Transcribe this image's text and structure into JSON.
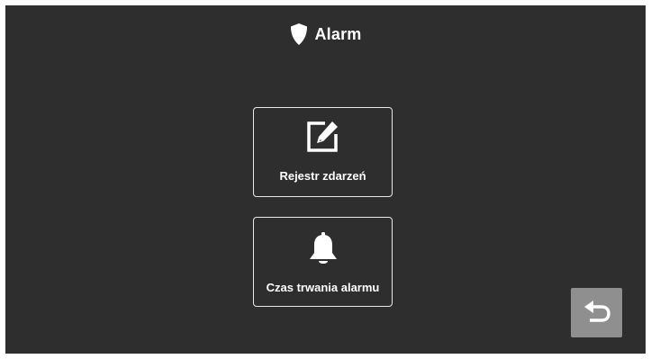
{
  "header": {
    "title": "Alarm",
    "icon": "shield-icon"
  },
  "menu": {
    "items": [
      {
        "label": "Rejestr zdarzeń",
        "icon": "edit-icon"
      },
      {
        "label": "Czas trwania alarmu",
        "icon": "bell-icon"
      }
    ]
  },
  "back_button": {
    "icon": "return-arrow-icon"
  },
  "colors": {
    "background": "#2e2e2e",
    "foreground": "#ffffff",
    "back_button": "#8f8f8f"
  }
}
